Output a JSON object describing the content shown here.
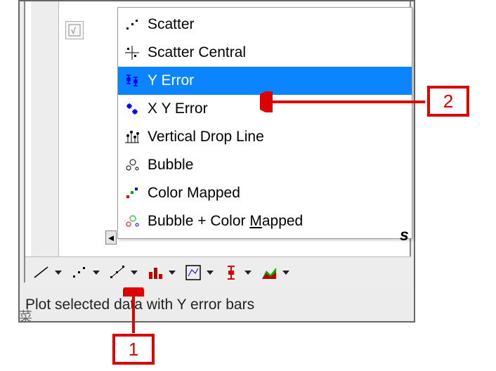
{
  "menu": {
    "items": [
      {
        "label": "Scatter",
        "selected": false,
        "icon": "scatter"
      },
      {
        "label": "Scatter Central",
        "selected": false,
        "icon": "scatter-central"
      },
      {
        "label": "Y Error",
        "selected": true,
        "icon": "y-error"
      },
      {
        "label": "X Y Error",
        "selected": false,
        "icon": "xy-error"
      },
      {
        "label": "Vertical Drop Line",
        "selected": false,
        "icon": "drop-line"
      },
      {
        "label": "Bubble",
        "selected": false,
        "icon": "bubble"
      },
      {
        "label": "Color Mapped",
        "selected": false,
        "icon": "color-mapped"
      },
      {
        "label": "Bubble + Color Mapped",
        "selected": false,
        "icon": "bubble-color",
        "underline_char": "M"
      }
    ]
  },
  "toolbar": {
    "buttons": [
      "line",
      "scatter",
      "line-symbol",
      "column",
      "box",
      "error",
      "area"
    ]
  },
  "status_text": "Plot selected data with Y error bars",
  "callouts": {
    "c1": "1",
    "c2": "2"
  },
  "corner_text": "菜"
}
